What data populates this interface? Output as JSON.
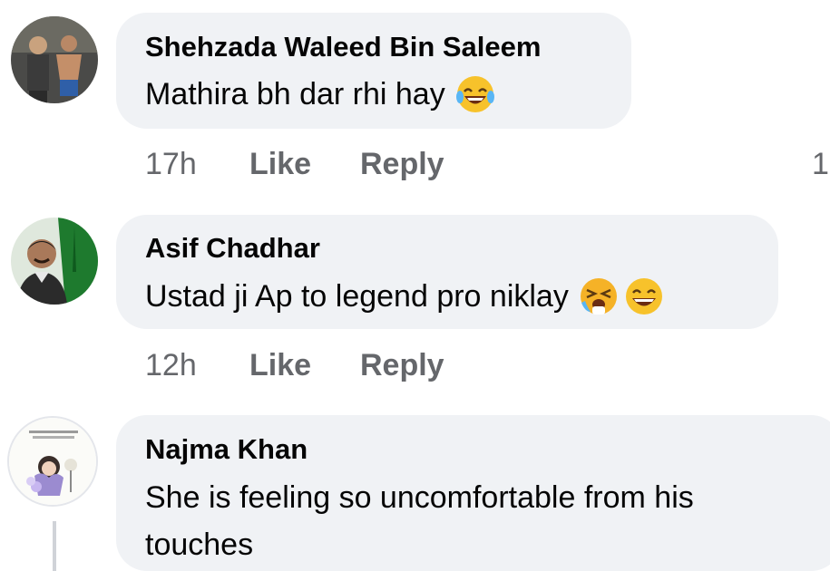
{
  "comments": [
    {
      "author": "Shehzada Waleed Bin Saleem",
      "text": "Mathira bh dar rhi hay",
      "emojis": [
        "laughing-tears-emoji"
      ],
      "time": "17h",
      "like_label": "Like",
      "reply_label": "Reply",
      "reaction_count": "1"
    },
    {
      "author": "Asif Chadhar",
      "text": "Ustad ji Ap to legend pro niklay",
      "emojis": [
        "crying-laughing-emoji",
        "grinning-squint-emoji"
      ],
      "time": "12h",
      "like_label": "Like",
      "reply_label": "Reply"
    },
    {
      "author": "Najma Khan",
      "text_line1": "She is feeling so uncomfortable from his",
      "text_line2": "touches"
    }
  ]
}
